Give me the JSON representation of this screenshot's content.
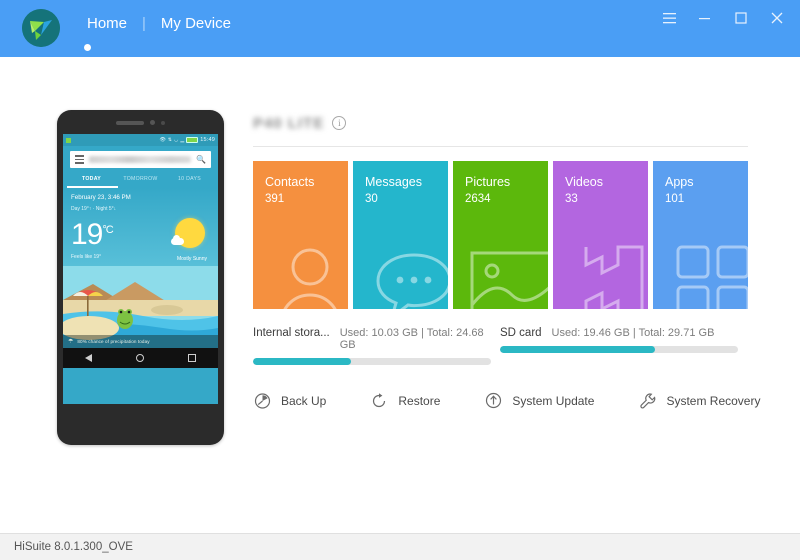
{
  "titlebar": {
    "tabs": [
      {
        "label": "Home",
        "active": true
      },
      {
        "label": "My Device",
        "active": false
      }
    ],
    "separator": "|",
    "controls": [
      {
        "name": "menu-button",
        "glyph": "☰"
      },
      {
        "name": "minimize-button",
        "glyph": "–"
      },
      {
        "name": "maximize-button",
        "glyph": "□"
      },
      {
        "name": "close-button",
        "glyph": "✕"
      }
    ],
    "accent_color": "#4a9ef5"
  },
  "device": {
    "name_blurred": "P40 LITE",
    "info_icon": "i"
  },
  "tiles": [
    {
      "label": "Contacts",
      "count": "391",
      "color": "#f5903f",
      "icon": "contact-person-icon"
    },
    {
      "label": "Messages",
      "count": "30",
      "color": "#24b6cc",
      "icon": "speech-bubble-icon"
    },
    {
      "label": "Pictures",
      "count": "2634",
      "color": "#5cb80c",
      "icon": "landscape-photo-icon"
    },
    {
      "label": "Videos",
      "count": "33",
      "color": "#b366e0",
      "icon": "film-strip-icon"
    },
    {
      "label": "Apps",
      "count": "101",
      "color": "#5b9ff0",
      "icon": "app-grid-icon"
    }
  ],
  "storage": [
    {
      "name": "Internal stora...",
      "detail": "Used: 10.03 GB | Total: 24.68 GB",
      "used_gb": 10.03,
      "total_gb": 24.68,
      "percent": 41
    },
    {
      "name": "SD card",
      "detail": "Used: 19.46 GB | Total: 29.71 GB",
      "used_gb": 19.46,
      "total_gb": 29.71,
      "percent": 65
    }
  ],
  "storage_bar_color": "#2bb8c4",
  "actions": [
    {
      "label": "Back Up",
      "icon": "backup-clock-icon"
    },
    {
      "label": "Restore",
      "icon": "restore-arrow-icon"
    },
    {
      "label": "System Update",
      "icon": "up-arrow-circle-icon"
    },
    {
      "label": "System Recovery",
      "icon": "wrench-icon"
    }
  ],
  "phone": {
    "status": {
      "time": "15:49",
      "battery": "battery-icon",
      "wifi": "wifi-icon",
      "signal": "signal-icon"
    },
    "search_placeholder": "",
    "tabs": [
      {
        "label": "TODAY",
        "active": true
      },
      {
        "label": "TOMORROW",
        "active": false
      },
      {
        "label": "10 DAYS",
        "active": false
      }
    ],
    "weather": {
      "date": "February 23, 3:46 PM",
      "day_night": "Day 19°↑ · Night 5°↓",
      "temperature": "19",
      "unit": "°C",
      "feels_like": "Feels like 19°",
      "condition": "Mostly Sunny",
      "precipitation": "80% chance of precipitation today"
    },
    "nav": [
      "back-button",
      "home-button",
      "recents-button"
    ]
  },
  "footer": {
    "version": "HiSuite 8.0.1.300_OVE"
  }
}
